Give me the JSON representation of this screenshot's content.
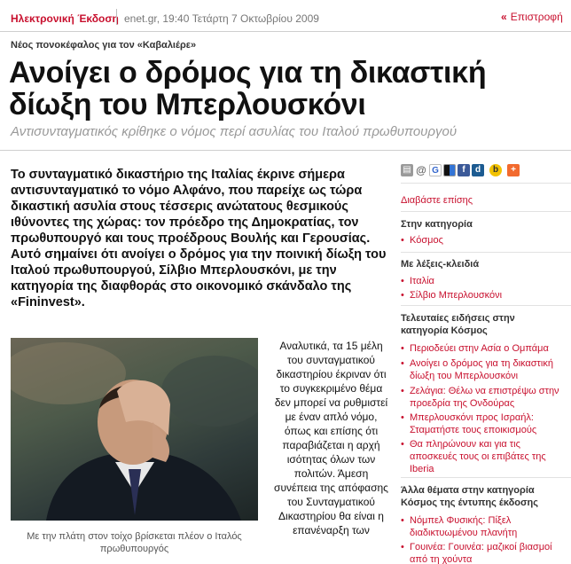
{
  "topbar": {
    "edition": "Ηλεκτρονική Έκδοση",
    "dateline": "enet.gr, 19:40 Τετάρτη 7 Οκτωβρίου 2009",
    "back_arrows": "«",
    "back_label": "Επιστροφή"
  },
  "article": {
    "kicker": "Νέος πονοκέφαλος για τον «Καβαλιέρε»",
    "headline": "Ανοίγει ο δρόμος για τη δικαστική δίωξη του Μπερλουσκόνι",
    "subhead": "Αντισυνταγματικός κρίθηκε ο νόμος περί ασυλίας του Ιταλού πρωθυπουργού",
    "lead": "Το συνταγματικό δικαστήριο της Ιταλίας έκρινε σήμερα αντισυνταγματικό το νόμο Αλφάνο, που παρείχε ως τώρα δικαστική ασυλία στους τέσσερις ανώτατους θεσμικούς ιθύνοντες της χώρας: τον πρόεδρο της Δημοκρατίας, τον πρωθυπουργό και τους προέδρους Βουλής και Γερουσίας. Αυτό σημαίνει ότι ανοίγει ο δρόμος για την ποινική δίωξη του Ιταλού πρωθυπουργού, Σίλβιο Μπερλουσκόνι, με την κατηγορία της διαφθοράς στο οικονομικό σκάνδαλο της «Fininvest».",
    "photo_caption": "Με την πλάτη στον τοίχο βρίσκεται πλέον ο Ιταλός πρωθυπουργός",
    "body": "Αναλυτικά, τα 15 μέλη του συνταγματικού δικαστηρίου έκριναν ότι το συγκεκριμένο θέμα δεν μπορεί να ρυθμιστεί με έναν απλό νόμο, όπως και επίσης ότι παραβιάζεται η αρχή ισότητας όλων των πολιτών. Άμεση συνέπεια της απόφασης του Συνταγματικού Δικαστηρίου θα είναι η επανέναρξη των"
  },
  "sidebar": {
    "share_icons": [
      "print-icon",
      "email-icon",
      "google-icon",
      "delicious-icon",
      "facebook-icon",
      "digg-icon",
      "buzz-icon",
      "addthis-icon"
    ],
    "read_also": "Διαβάστε επίσης",
    "category_head": "Στην κατηγορία",
    "category_links": [
      "Κόσμος"
    ],
    "keywords_head": "Με λέξεις-κλειδιά",
    "keyword_links": [
      "Ιταλία",
      "Σίλβιο Μπερλουσκόνι"
    ],
    "latest_head": "Τελευταίες ειδήσεις στην κατηγορία Κόσμος",
    "latest_links": [
      "Περιοδεύει στην Ασία ο Ομπάμα",
      "Ανοίγει ο δρόμος για τη δικαστική δίωξη του Μπερλουσκόνι",
      "Ζελάγια: Θέλω να επιστρέψω στην προεδρία της Ονδούρας",
      "Μπερλουσκόνι προς Ισραήλ: Σταματήστε τους εποικισμούς",
      "Θα πληρώνουν και για τις αποσκευές τους οι επιβάτες της Iberia"
    ],
    "other_head": "Άλλα θέματα στην κατηγορία Κόσμος της έντυπης έκδοσης",
    "other_links": [
      "Νόμπελ Φυσικής: Πίξελ διαδικτυωμένου πλανήτη",
      "Γουινέα: Γουινέα: μαζικοί βιασμοί από τη χούντα"
    ]
  },
  "colors": {
    "accent_red": "#c8102e",
    "muted_gray": "#999999",
    "rule_gray": "#cfcfcf"
  }
}
